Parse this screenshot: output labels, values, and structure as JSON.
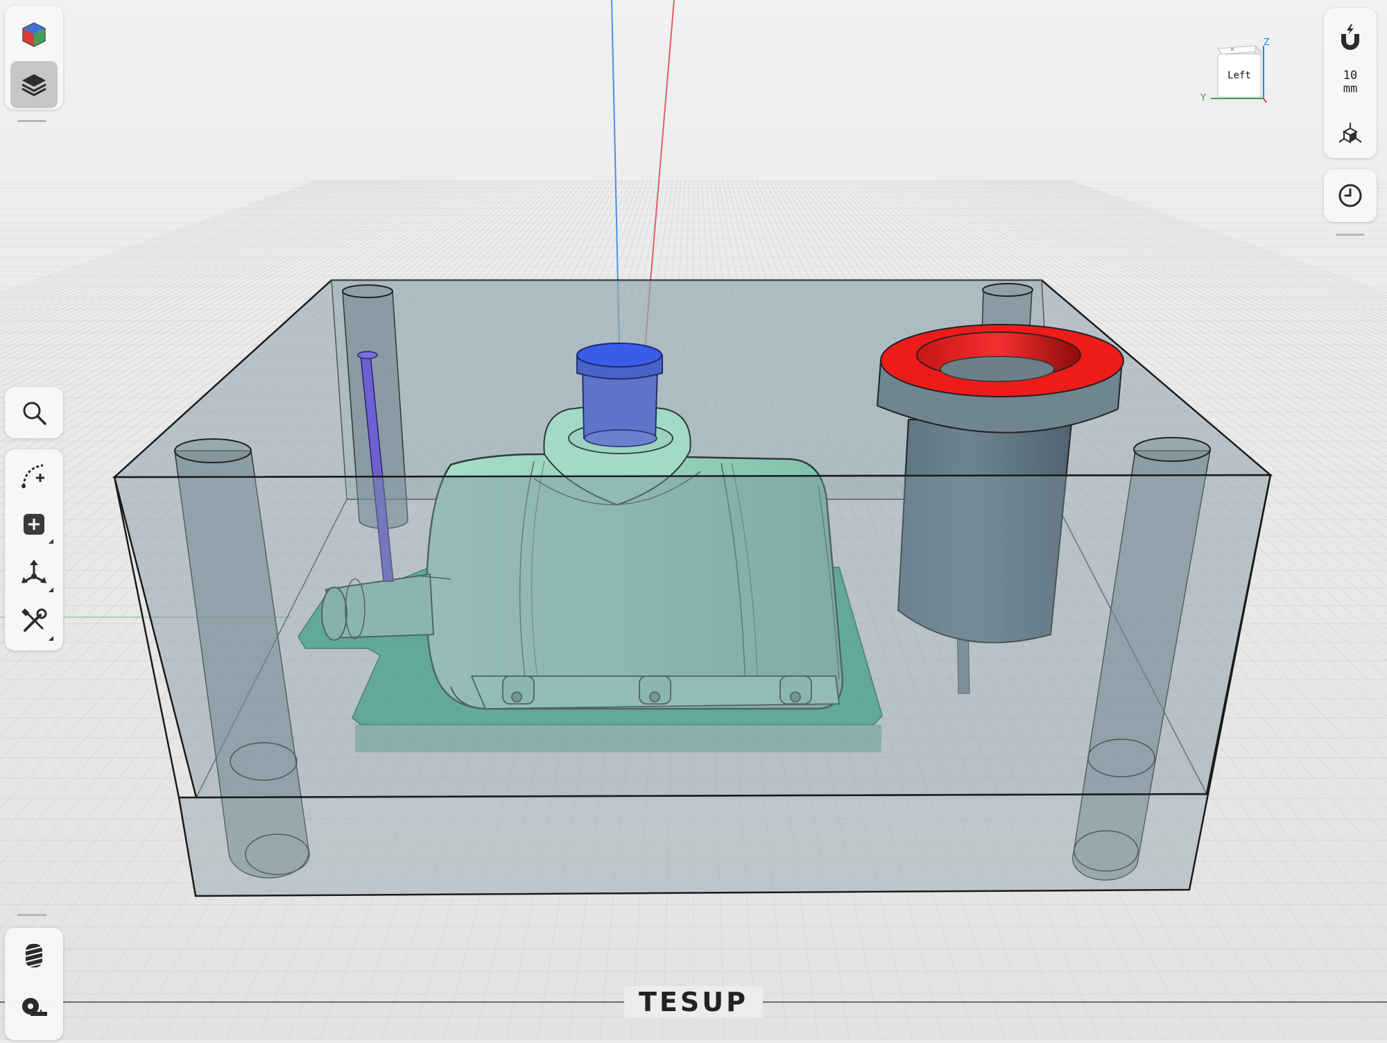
{
  "app": {
    "brand": "TESUP"
  },
  "left_toolbar": {
    "top": [
      {
        "name": "view-mode-cube-icon"
      },
      {
        "name": "layers-icon",
        "active": true
      }
    ],
    "middle": [
      {
        "name": "search-icon"
      }
    ],
    "tools": [
      {
        "name": "arc-add-point-icon"
      },
      {
        "name": "add-primitive-icon"
      },
      {
        "name": "move-transform-icon"
      },
      {
        "name": "tools-icon"
      }
    ],
    "bottom": [
      {
        "name": "thread-icon"
      },
      {
        "name": "measure-tape-icon"
      }
    ]
  },
  "right_toolbar": {
    "snap": {
      "icon": "magnet-snap-icon",
      "value": "10",
      "unit": "mm"
    },
    "view_icon": "axis-cube-icon",
    "history_icon": "history-clock-icon"
  },
  "view_cube": {
    "face_label": "Left",
    "axis_z": "Z",
    "axis_y": "Y",
    "axis_x_color": "#e53935",
    "axis_y_color": "#43a047",
    "axis_z_color": "#1e88e5"
  },
  "scene": {
    "mold_color": "#7f95a0",
    "part_color": "#8fd3bd",
    "cap_color": "#3b5bea",
    "ring_color": "#ee1b1b",
    "pin_color": "#6e5fd3"
  }
}
